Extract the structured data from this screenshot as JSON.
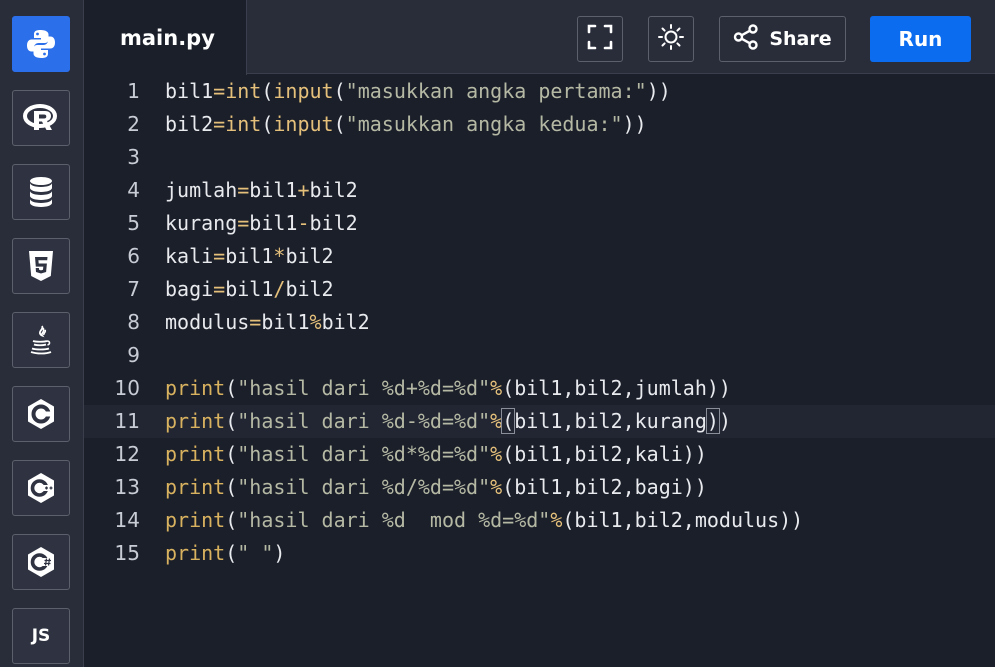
{
  "sidebar": {
    "items": [
      {
        "name": "python",
        "icon": "python-icon",
        "active": true
      },
      {
        "name": "r",
        "icon": "r-icon"
      },
      {
        "name": "sql",
        "icon": "database-icon"
      },
      {
        "name": "html",
        "icon": "html5-icon"
      },
      {
        "name": "java",
        "icon": "java-icon"
      },
      {
        "name": "c",
        "icon": "c-icon"
      },
      {
        "name": "cpp",
        "icon": "cpp-icon"
      },
      {
        "name": "csharp",
        "icon": "csharp-icon"
      },
      {
        "name": "javascript",
        "icon": "js-icon",
        "label": "JS"
      }
    ]
  },
  "header": {
    "file_name": "main.py",
    "share_label": "Share",
    "run_label": "Run"
  },
  "colors": {
    "accent": "#0b6cf0",
    "background": "#1b1f2a",
    "panel": "#292d3a",
    "operator": "#e5c07b",
    "string": "#b5b9a4"
  },
  "editor": {
    "active_line": 11,
    "lines": [
      {
        "num": "1",
        "tokens": [
          [
            "def",
            "bil1"
          ],
          [
            "op",
            "="
          ],
          [
            "fn",
            "int"
          ],
          [
            "def",
            "("
          ],
          [
            "fn",
            "input"
          ],
          [
            "def",
            "("
          ],
          [
            "str",
            "\"masukkan angka pertama:\""
          ],
          [
            "def",
            "))"
          ]
        ]
      },
      {
        "num": "2",
        "tokens": [
          [
            "def",
            "bil2"
          ],
          [
            "op",
            "="
          ],
          [
            "fn",
            "int"
          ],
          [
            "def",
            "("
          ],
          [
            "fn",
            "input"
          ],
          [
            "def",
            "("
          ],
          [
            "str",
            "\"masukkan angka kedua:\""
          ],
          [
            "def",
            "))"
          ]
        ]
      },
      {
        "num": "3",
        "tokens": []
      },
      {
        "num": "4",
        "tokens": [
          [
            "def",
            "jumlah"
          ],
          [
            "op",
            "="
          ],
          [
            "def",
            "bil1"
          ],
          [
            "op",
            "+"
          ],
          [
            "def",
            "bil2"
          ]
        ]
      },
      {
        "num": "5",
        "tokens": [
          [
            "def",
            "kurang"
          ],
          [
            "op",
            "="
          ],
          [
            "def",
            "bil1"
          ],
          [
            "op",
            "-"
          ],
          [
            "def",
            "bil2"
          ]
        ]
      },
      {
        "num": "6",
        "tokens": [
          [
            "def",
            "kali"
          ],
          [
            "op",
            "="
          ],
          [
            "def",
            "bil1"
          ],
          [
            "op",
            "*"
          ],
          [
            "def",
            "bil2"
          ]
        ]
      },
      {
        "num": "7",
        "tokens": [
          [
            "def",
            "bagi"
          ],
          [
            "op",
            "="
          ],
          [
            "def",
            "bil1"
          ],
          [
            "op",
            "/"
          ],
          [
            "def",
            "bil2"
          ]
        ]
      },
      {
        "num": "8",
        "tokens": [
          [
            "def",
            "modulus"
          ],
          [
            "op",
            "="
          ],
          [
            "def",
            "bil1"
          ],
          [
            "op",
            "%"
          ],
          [
            "def",
            "bil2"
          ]
        ]
      },
      {
        "num": "9",
        "tokens": []
      },
      {
        "num": "10",
        "tokens": [
          [
            "kw",
            "print"
          ],
          [
            "def",
            "("
          ],
          [
            "str",
            "\"hasil dari %d+%d=%d\""
          ],
          [
            "op",
            "%"
          ],
          [
            "def",
            "(bil1,bil2,jumlah))"
          ]
        ]
      },
      {
        "num": "11",
        "tokens": [
          [
            "kw",
            "print"
          ],
          [
            "def",
            "("
          ],
          [
            "str",
            "\"hasil dari %d-%d=%d\""
          ],
          [
            "op",
            "%"
          ],
          [
            "match",
            "("
          ],
          [
            "def",
            "bil1,bil2,kurang"
          ],
          [
            "match",
            ")"
          ],
          [
            "def",
            ")"
          ]
        ]
      },
      {
        "num": "12",
        "tokens": [
          [
            "kw",
            "print"
          ],
          [
            "def",
            "("
          ],
          [
            "str",
            "\"hasil dari %d*%d=%d\""
          ],
          [
            "op",
            "%"
          ],
          [
            "def",
            "(bil1,bil2,kali))"
          ]
        ]
      },
      {
        "num": "13",
        "tokens": [
          [
            "kw",
            "print"
          ],
          [
            "def",
            "("
          ],
          [
            "str",
            "\"hasil dari %d/%d=%d\""
          ],
          [
            "op",
            "%"
          ],
          [
            "def",
            "(bil1,bil2,bagi))"
          ]
        ]
      },
      {
        "num": "14",
        "tokens": [
          [
            "kw",
            "print"
          ],
          [
            "def",
            "("
          ],
          [
            "str",
            "\"hasil dari %d  mod %d=%d\""
          ],
          [
            "op",
            "%"
          ],
          [
            "def",
            "(bil1,bil2,modulus))"
          ]
        ]
      },
      {
        "num": "15",
        "tokens": [
          [
            "kw",
            "print"
          ],
          [
            "def",
            "("
          ],
          [
            "str",
            "\" \""
          ],
          [
            "def",
            ")"
          ]
        ]
      }
    ]
  }
}
